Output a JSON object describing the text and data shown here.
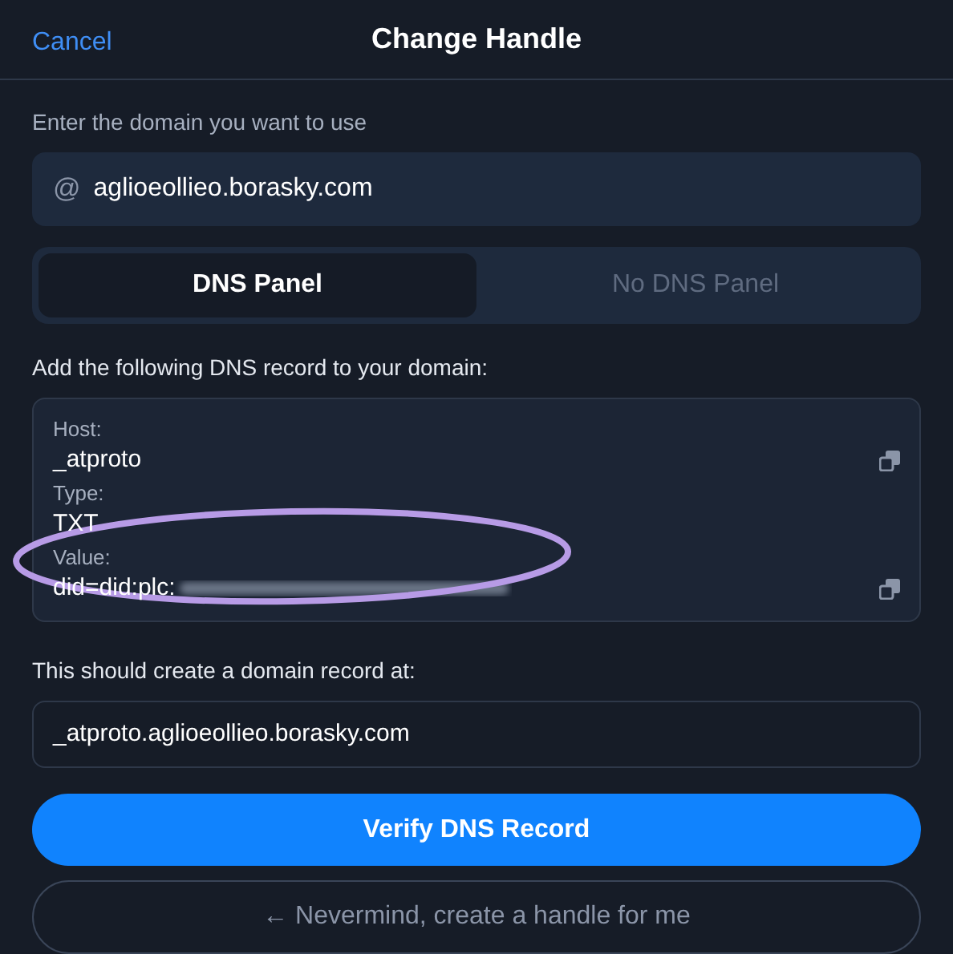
{
  "header": {
    "cancel": "Cancel",
    "title": "Change Handle"
  },
  "domain": {
    "label": "Enter the domain you want to use",
    "prefix": "@",
    "value": "aglioeollieo.borasky.com"
  },
  "tabs": [
    {
      "label": "DNS Panel",
      "selected": true
    },
    {
      "label": "No DNS Panel",
      "selected": false
    }
  ],
  "record": {
    "label": "Add the following DNS record to your domain:",
    "fields": [
      {
        "label": "Host:",
        "value": "_atproto",
        "copyable": true,
        "redacted": false
      },
      {
        "label": "Type:",
        "value": "TXT",
        "copyable": false,
        "redacted": false
      },
      {
        "label": "Value:",
        "value": "did=did:plc:",
        "copyable": true,
        "redacted": true
      }
    ]
  },
  "result": {
    "label": "This should create a domain record at:",
    "value": "_atproto.aglioeollieo.borasky.com"
  },
  "buttons": [
    {
      "label": "Verify DNS Record",
      "kind": "primary"
    },
    {
      "label": "← Nevermind, create a handle for me",
      "kind": "outline"
    }
  ]
}
